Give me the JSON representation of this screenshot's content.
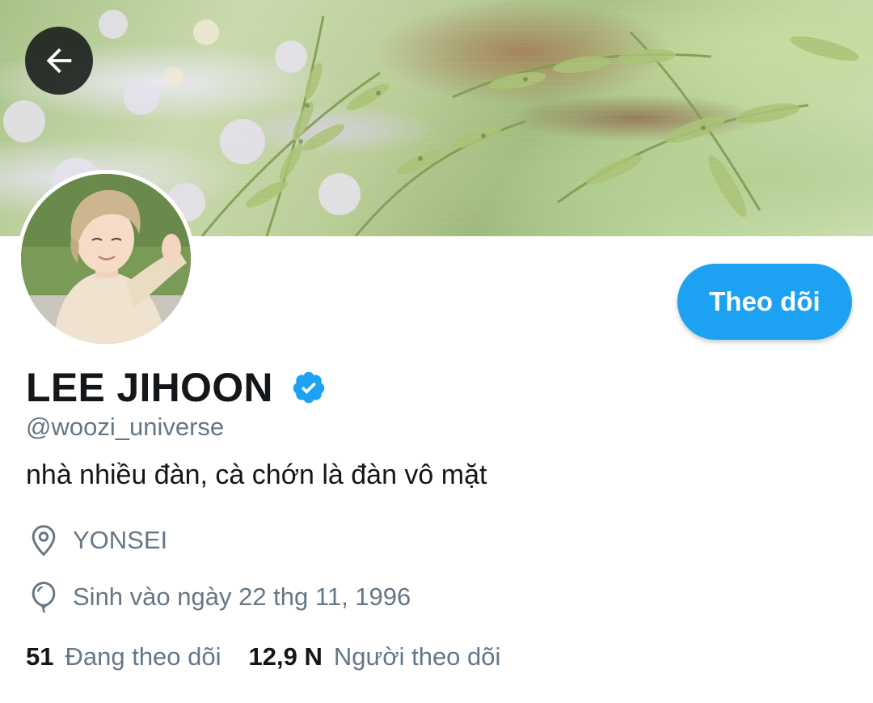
{
  "profile": {
    "display_name": "LEE JIHOON",
    "handle": "@woozi_universe",
    "bio": "nhà nhiều đàn, cà chớn là đàn vô mặt",
    "location": "YONSEI",
    "birthday": "Sinh vào ngày 22 thg 11, 1996",
    "verified": true
  },
  "actions": {
    "follow_label": "Theo dõi"
  },
  "stats": {
    "following_count": "51",
    "following_label": "Đang theo dõi",
    "followers_count": "12,9 N",
    "followers_label": "Người theo dõi"
  },
  "icons": {
    "back": "arrow-left-icon",
    "verified": "verified-badge-icon",
    "location": "location-pin-icon",
    "birthday": "balloon-icon"
  },
  "colors": {
    "accent": "#1da1f2",
    "text_primary": "#14171a",
    "text_secondary": "#657786",
    "background": "#ffffff"
  }
}
